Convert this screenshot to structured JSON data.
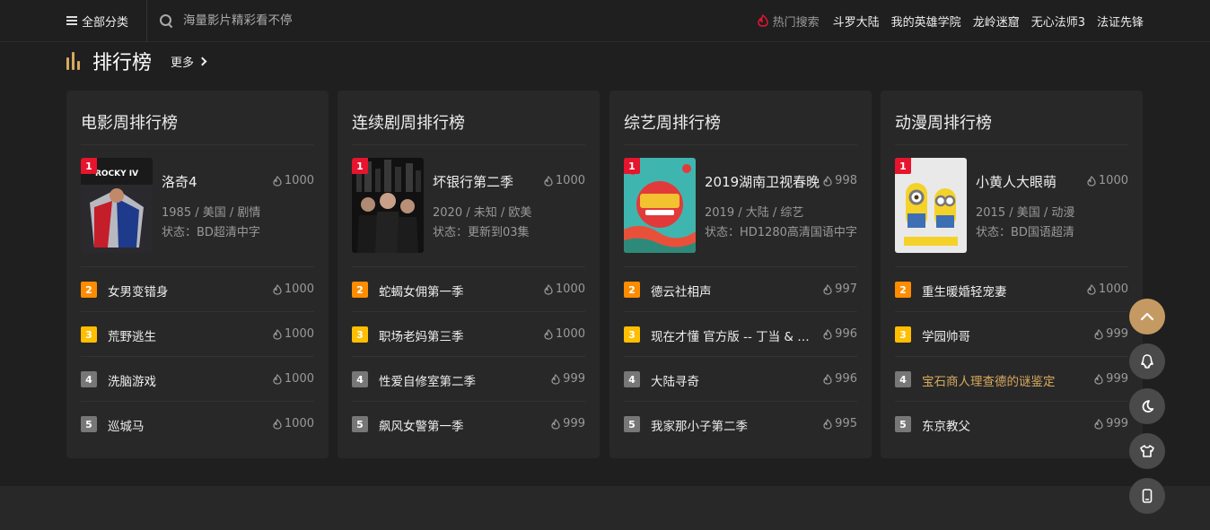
{
  "header": {
    "all_categories": "全部分类",
    "search_placeholder": "海量影片精彩看不停",
    "hot_label": "热门搜索",
    "hot_links": [
      "斗罗大陆",
      "我的英雄学院",
      "龙岭迷窟",
      "无心法师3",
      "法证先锋"
    ]
  },
  "section": {
    "title": "排行榜",
    "more": "更多"
  },
  "colors": {
    "accent": "#d6a85e",
    "rank1": "#e6142d",
    "rank2": "#ff8c00",
    "rank3": "#ffbe00",
    "rank_other": "#777777"
  },
  "cards": [
    {
      "title": "电影周排行榜",
      "top": {
        "rank": "1",
        "name": "洛奇4",
        "heat": "1000",
        "meta": "1985 / 美国 / 剧情",
        "status": "状态：BD超清中字"
      },
      "rows": [
        {
          "rank": "2",
          "name": "女男变错身",
          "heat": "1000"
        },
        {
          "rank": "3",
          "name": "荒野逃生",
          "heat": "1000"
        },
        {
          "rank": "4",
          "name": "洗脑游戏",
          "heat": "1000"
        },
        {
          "rank": "5",
          "name": "巡城马",
          "heat": "1000"
        }
      ]
    },
    {
      "title": "连续剧周排行榜",
      "top": {
        "rank": "1",
        "name": "坏银行第二季",
        "heat": "1000",
        "meta": "2020 / 未知 / 欧美",
        "status": "状态：更新到03集"
      },
      "rows": [
        {
          "rank": "2",
          "name": "蛇蝎女佣第一季",
          "heat": "1000"
        },
        {
          "rank": "3",
          "name": "职场老妈第三季",
          "heat": "1000"
        },
        {
          "rank": "4",
          "name": "性爱自修室第二季",
          "heat": "999"
        },
        {
          "rank": "5",
          "name": "飙风女警第一季",
          "heat": "999"
        }
      ]
    },
    {
      "title": "综艺周排行榜",
      "top": {
        "rank": "1",
        "name": "2019湖南卫视春晚",
        "heat": "998",
        "meta": "2019 / 大陆 / 综艺",
        "status": "状态：HD1280高清国语中字"
      },
      "rows": [
        {
          "rank": "2",
          "name": "德云社相声",
          "heat": "997"
        },
        {
          "rank": "3",
          "name": "现在才懂 官方版 -- 丁当 & 吴克群",
          "heat": "996"
        },
        {
          "rank": "4",
          "name": "大陆寻奇",
          "heat": "996"
        },
        {
          "rank": "5",
          "name": "我家那小子第二季",
          "heat": "995"
        }
      ]
    },
    {
      "title": "动漫周排行榜",
      "top": {
        "rank": "1",
        "name": "小黄人大眼萌",
        "heat": "1000",
        "meta": "2015 / 美国 / 动漫",
        "status": "状态：BD国语超清"
      },
      "rows": [
        {
          "rank": "2",
          "name": "重生暖婚轻宠妻",
          "heat": "1000"
        },
        {
          "rank": "3",
          "name": "学园帅哥",
          "heat": "999"
        },
        {
          "rank": "4",
          "name": "宝石商人理查德的谜鉴定",
          "heat": "999"
        },
        {
          "rank": "5",
          "name": "东京教父",
          "heat": "999"
        }
      ]
    }
  ],
  "poster_text": {
    "movie": "ROCKY IV"
  },
  "floating_buttons": [
    "arrow-up-icon",
    "qq-icon",
    "moon-icon",
    "tshirt-icon",
    "phone-icon"
  ]
}
